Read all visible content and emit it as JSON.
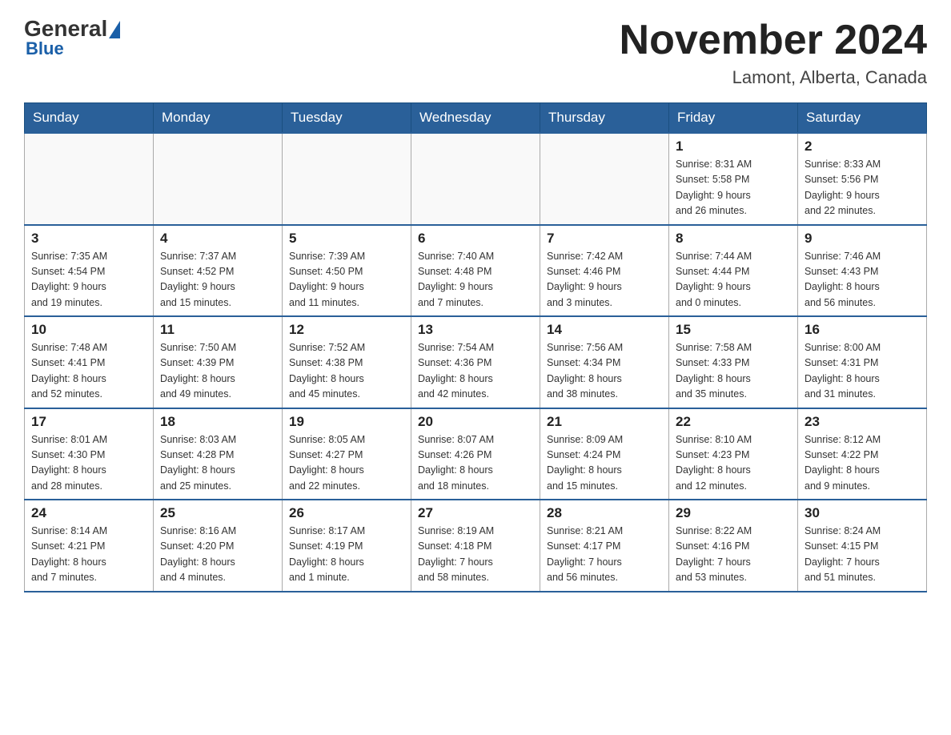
{
  "header": {
    "logo_general": "General",
    "logo_blue": "Blue",
    "main_title": "November 2024",
    "subtitle": "Lamont, Alberta, Canada"
  },
  "days_of_week": [
    "Sunday",
    "Monday",
    "Tuesday",
    "Wednesday",
    "Thursday",
    "Friday",
    "Saturday"
  ],
  "weeks": [
    [
      {
        "day": "",
        "info": ""
      },
      {
        "day": "",
        "info": ""
      },
      {
        "day": "",
        "info": ""
      },
      {
        "day": "",
        "info": ""
      },
      {
        "day": "",
        "info": ""
      },
      {
        "day": "1",
        "info": "Sunrise: 8:31 AM\nSunset: 5:58 PM\nDaylight: 9 hours\nand 26 minutes."
      },
      {
        "day": "2",
        "info": "Sunrise: 8:33 AM\nSunset: 5:56 PM\nDaylight: 9 hours\nand 22 minutes."
      }
    ],
    [
      {
        "day": "3",
        "info": "Sunrise: 7:35 AM\nSunset: 4:54 PM\nDaylight: 9 hours\nand 19 minutes."
      },
      {
        "day": "4",
        "info": "Sunrise: 7:37 AM\nSunset: 4:52 PM\nDaylight: 9 hours\nand 15 minutes."
      },
      {
        "day": "5",
        "info": "Sunrise: 7:39 AM\nSunset: 4:50 PM\nDaylight: 9 hours\nand 11 minutes."
      },
      {
        "day": "6",
        "info": "Sunrise: 7:40 AM\nSunset: 4:48 PM\nDaylight: 9 hours\nand 7 minutes."
      },
      {
        "day": "7",
        "info": "Sunrise: 7:42 AM\nSunset: 4:46 PM\nDaylight: 9 hours\nand 3 minutes."
      },
      {
        "day": "8",
        "info": "Sunrise: 7:44 AM\nSunset: 4:44 PM\nDaylight: 9 hours\nand 0 minutes."
      },
      {
        "day": "9",
        "info": "Sunrise: 7:46 AM\nSunset: 4:43 PM\nDaylight: 8 hours\nand 56 minutes."
      }
    ],
    [
      {
        "day": "10",
        "info": "Sunrise: 7:48 AM\nSunset: 4:41 PM\nDaylight: 8 hours\nand 52 minutes."
      },
      {
        "day": "11",
        "info": "Sunrise: 7:50 AM\nSunset: 4:39 PM\nDaylight: 8 hours\nand 49 minutes."
      },
      {
        "day": "12",
        "info": "Sunrise: 7:52 AM\nSunset: 4:38 PM\nDaylight: 8 hours\nand 45 minutes."
      },
      {
        "day": "13",
        "info": "Sunrise: 7:54 AM\nSunset: 4:36 PM\nDaylight: 8 hours\nand 42 minutes."
      },
      {
        "day": "14",
        "info": "Sunrise: 7:56 AM\nSunset: 4:34 PM\nDaylight: 8 hours\nand 38 minutes."
      },
      {
        "day": "15",
        "info": "Sunrise: 7:58 AM\nSunset: 4:33 PM\nDaylight: 8 hours\nand 35 minutes."
      },
      {
        "day": "16",
        "info": "Sunrise: 8:00 AM\nSunset: 4:31 PM\nDaylight: 8 hours\nand 31 minutes."
      }
    ],
    [
      {
        "day": "17",
        "info": "Sunrise: 8:01 AM\nSunset: 4:30 PM\nDaylight: 8 hours\nand 28 minutes."
      },
      {
        "day": "18",
        "info": "Sunrise: 8:03 AM\nSunset: 4:28 PM\nDaylight: 8 hours\nand 25 minutes."
      },
      {
        "day": "19",
        "info": "Sunrise: 8:05 AM\nSunset: 4:27 PM\nDaylight: 8 hours\nand 22 minutes."
      },
      {
        "day": "20",
        "info": "Sunrise: 8:07 AM\nSunset: 4:26 PM\nDaylight: 8 hours\nand 18 minutes."
      },
      {
        "day": "21",
        "info": "Sunrise: 8:09 AM\nSunset: 4:24 PM\nDaylight: 8 hours\nand 15 minutes."
      },
      {
        "day": "22",
        "info": "Sunrise: 8:10 AM\nSunset: 4:23 PM\nDaylight: 8 hours\nand 12 minutes."
      },
      {
        "day": "23",
        "info": "Sunrise: 8:12 AM\nSunset: 4:22 PM\nDaylight: 8 hours\nand 9 minutes."
      }
    ],
    [
      {
        "day": "24",
        "info": "Sunrise: 8:14 AM\nSunset: 4:21 PM\nDaylight: 8 hours\nand 7 minutes."
      },
      {
        "day": "25",
        "info": "Sunrise: 8:16 AM\nSunset: 4:20 PM\nDaylight: 8 hours\nand 4 minutes."
      },
      {
        "day": "26",
        "info": "Sunrise: 8:17 AM\nSunset: 4:19 PM\nDaylight: 8 hours\nand 1 minute."
      },
      {
        "day": "27",
        "info": "Sunrise: 8:19 AM\nSunset: 4:18 PM\nDaylight: 7 hours\nand 58 minutes."
      },
      {
        "day": "28",
        "info": "Sunrise: 8:21 AM\nSunset: 4:17 PM\nDaylight: 7 hours\nand 56 minutes."
      },
      {
        "day": "29",
        "info": "Sunrise: 8:22 AM\nSunset: 4:16 PM\nDaylight: 7 hours\nand 53 minutes."
      },
      {
        "day": "30",
        "info": "Sunrise: 8:24 AM\nSunset: 4:15 PM\nDaylight: 7 hours\nand 51 minutes."
      }
    ]
  ]
}
